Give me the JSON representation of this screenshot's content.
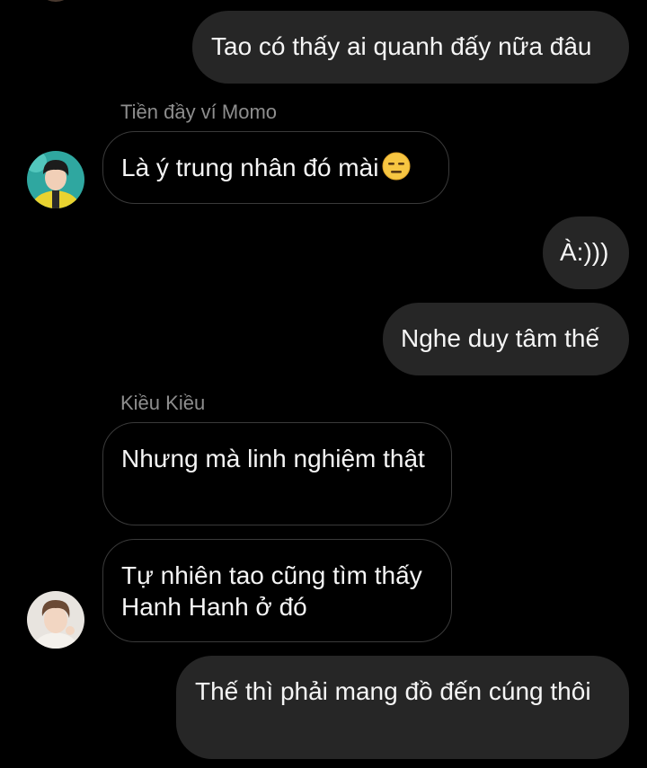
{
  "messages": [
    {
      "direction": "outgoing",
      "text": "Tao có thấy ai quanh đấy nữa đâu"
    },
    {
      "direction": "incoming",
      "sender": "Tiền đầy ví Momo",
      "text": "Là ý trung nhân đó mài",
      "emoji": "expressionless-face-emoji"
    },
    {
      "direction": "outgoing",
      "text": "À:)))"
    },
    {
      "direction": "outgoing",
      "text": "Nghe duy tâm thế"
    },
    {
      "direction": "incoming",
      "sender": "Kiều Kiều",
      "text": "Nhưng mà linh nghiệm thật"
    },
    {
      "direction": "incoming",
      "sender": "Kiều Kiều",
      "text": "Tự nhiên tao cũng tìm thấy Hanh Hanh ở đó"
    },
    {
      "direction": "outgoing",
      "text": "Thế thì phải mang đồ đến cúng thôi"
    }
  ],
  "colors": {
    "background": "#000000",
    "outgoing_bubble": "#262626",
    "incoming_border": "#3a3a3a",
    "sender_name": "#8e8e8e",
    "text": "#f5f5f5"
  }
}
